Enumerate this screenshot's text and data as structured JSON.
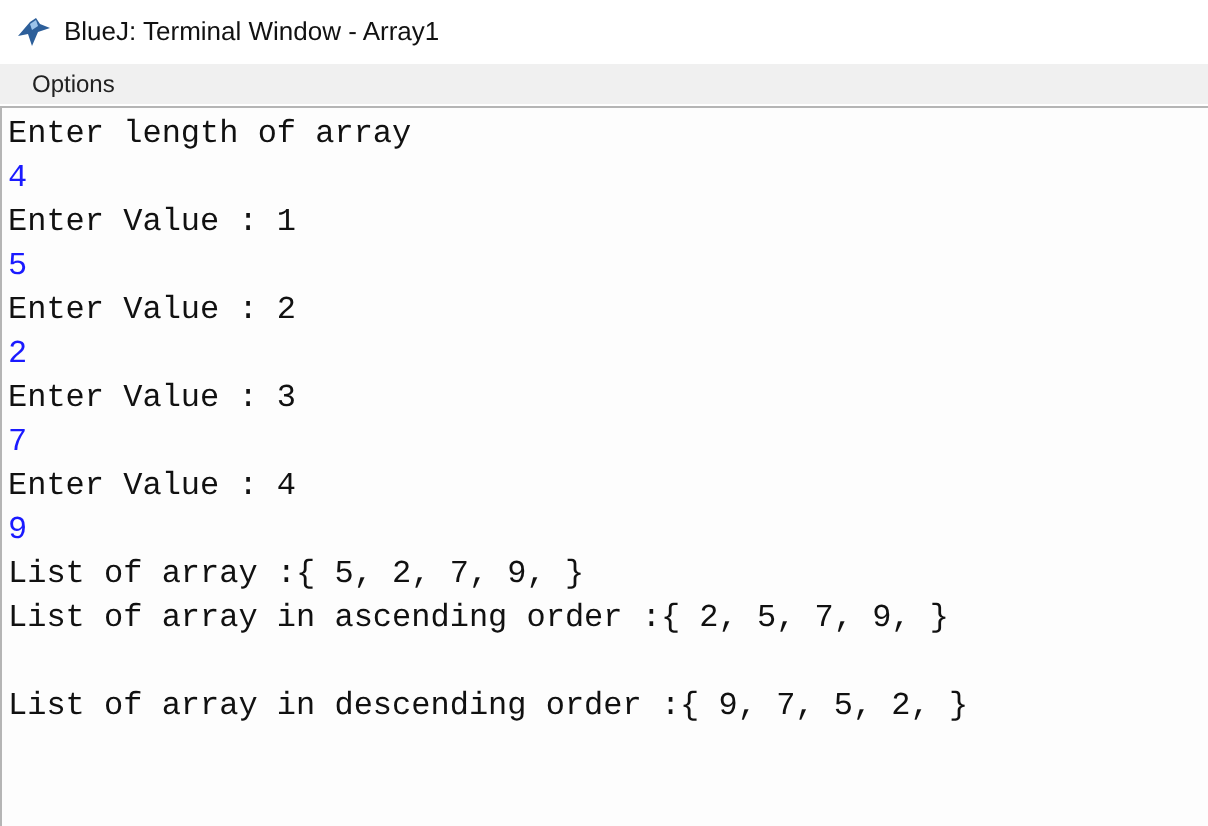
{
  "window": {
    "title": "BlueJ: Terminal Window - Array1"
  },
  "menu": [
    "Options"
  ],
  "terminal": {
    "lines": [
      {
        "kind": "output",
        "text": "Enter length of array"
      },
      {
        "kind": "input",
        "text": "4"
      },
      {
        "kind": "output",
        "text": "Enter Value : 1"
      },
      {
        "kind": "input",
        "text": "5"
      },
      {
        "kind": "output",
        "text": "Enter Value : 2"
      },
      {
        "kind": "input",
        "text": "2"
      },
      {
        "kind": "output",
        "text": "Enter Value : 3"
      },
      {
        "kind": "input",
        "text": "7"
      },
      {
        "kind": "output",
        "text": "Enter Value : 4"
      },
      {
        "kind": "input",
        "text": "9"
      },
      {
        "kind": "output",
        "text": "List of array :{ 5, 2, 7, 9, }"
      },
      {
        "kind": "output",
        "text": "List of array in ascending order :{ 2, 5, 7, 9, }"
      },
      {
        "kind": "blank"
      },
      {
        "kind": "output",
        "text": "List of array in descending order :{ 9, 7, 5, 2, }"
      }
    ]
  }
}
